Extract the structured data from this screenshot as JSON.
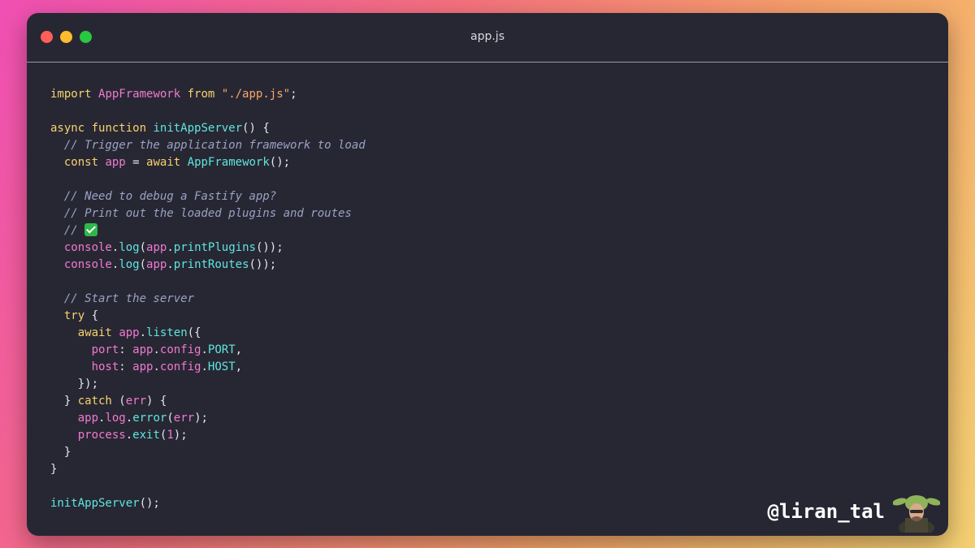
{
  "window": {
    "title": "app.js"
  },
  "code": {
    "l1": [
      "import",
      " ",
      "AppFramework",
      " ",
      "from",
      " ",
      "\"./app.js\"",
      ";"
    ],
    "l3": [
      "async",
      " ",
      "function",
      " ",
      "initAppServer",
      "() {"
    ],
    "l4": [
      "  ",
      "// Trigger the application framework to load"
    ],
    "l5": [
      "  ",
      "const",
      " ",
      "app",
      " = ",
      "await",
      " ",
      "AppFramework",
      "();"
    ],
    "l7": [
      "  ",
      "// Need to debug a Fastify app?"
    ],
    "l8": [
      "  ",
      "// Print out the loaded plugins and routes"
    ],
    "l9": [
      "  ",
      "// "
    ],
    "l10": [
      "  ",
      "console",
      ".",
      "log",
      "(",
      "app",
      ".",
      "printPlugins",
      "());"
    ],
    "l11": [
      "  ",
      "console",
      ".",
      "log",
      "(",
      "app",
      ".",
      "printRoutes",
      "());"
    ],
    "l13": [
      "  ",
      "// Start the server"
    ],
    "l14": [
      "  ",
      "try",
      " {"
    ],
    "l15": [
      "    ",
      "await",
      " ",
      "app",
      ".",
      "listen",
      "({"
    ],
    "l16": [
      "      ",
      "port",
      ": ",
      "app",
      ".",
      "config",
      ".",
      "PORT",
      ","
    ],
    "l17": [
      "      ",
      "host",
      ": ",
      "app",
      ".",
      "config",
      ".",
      "HOST",
      ","
    ],
    "l18": [
      "    ",
      "});"
    ],
    "l19": [
      "  ",
      "} ",
      "catch",
      " (",
      "err",
      ") {"
    ],
    "l20": [
      "    ",
      "app",
      ".",
      "log",
      ".",
      "error",
      "(",
      "err",
      ");"
    ],
    "l21": [
      "    ",
      "process",
      ".",
      "exit",
      "(",
      "1",
      ");"
    ],
    "l22": [
      "  ",
      "}"
    ],
    "l23": [
      "}"
    ],
    "l25": [
      "initAppServer",
      "();"
    ]
  },
  "footer": {
    "handle": "@liran_tal",
    "avatar_icon": "yoda-avatar"
  },
  "colors": {
    "keyword": "#f7d26e",
    "function": "#5ee6e0",
    "identifier": "#f07ad0",
    "string": "#f7a86a",
    "comment": "#9aa2c4",
    "background": "#272733"
  }
}
